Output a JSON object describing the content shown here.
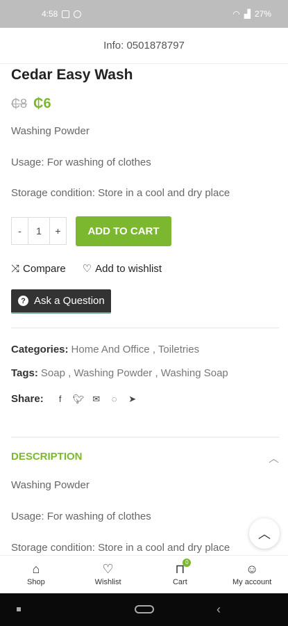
{
  "status": {
    "time": "4:58",
    "battery": "27%"
  },
  "info": "Info: 0501878797",
  "product": {
    "title": "Cedar Easy Wash",
    "old_price": "₵8",
    "new_price": "₵6",
    "lines": [
      "Washing Powder",
      "Usage: For washing of clothes",
      "Storage condition: Store in a cool and dry place"
    ]
  },
  "cart": {
    "minus": "-",
    "qty": "1",
    "plus": "+",
    "add_label": "ADD TO CART"
  },
  "actions": {
    "compare": "Compare",
    "wishlist": "Add to wishlist",
    "ask": "Ask a Question"
  },
  "meta": {
    "categories_label": "Categories:",
    "categories": "Home And Office , Toiletries",
    "tags_label": "Tags:",
    "tags": "Soap , Washing Powder , Washing Soap",
    "share_label": "Share:"
  },
  "description": {
    "heading": "DESCRIPTION",
    "lines": [
      "Washing Powder",
      "Usage: For washing of clothes",
      "Storage condition: Store in a cool and dry place"
    ]
  },
  "nav": {
    "shop": "Shop",
    "wishlist": "Wishlist",
    "cart": "Cart",
    "cart_count": "0",
    "account": "My account"
  },
  "colors": {
    "accent": "#7cb82f",
    "dark_button": "#333333"
  }
}
